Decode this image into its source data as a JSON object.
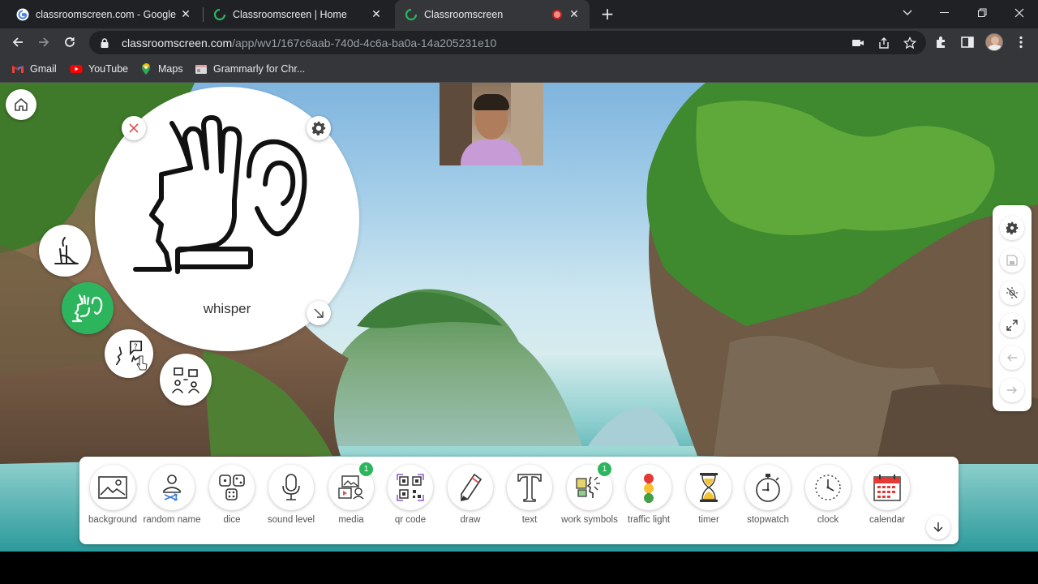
{
  "browser": {
    "tabs": [
      {
        "title": "classroomscreen.com - Google S",
        "favicon": "google-icon",
        "active": false
      },
      {
        "title": "Classroomscreen | Home",
        "favicon": "classroomscreen-icon",
        "active": false
      },
      {
        "title": "Classroomscreen",
        "favicon": "classroomscreen-icon",
        "active": true,
        "recording": true
      }
    ],
    "url_host": "classroomscreen.com",
    "url_path": "/app/wv1/167c6aab-740d-4c6a-ba0a-14a205231e10",
    "bookmarks": [
      {
        "label": "Gmail",
        "icon": "gmail-icon"
      },
      {
        "label": "YouTube",
        "icon": "youtube-icon"
      },
      {
        "label": "Maps",
        "icon": "maps-icon"
      },
      {
        "label": "Grammarly for Chr...",
        "icon": "grammarly-icon"
      }
    ]
  },
  "work_symbol": {
    "label": "whisper",
    "options": [
      "stand-quietly",
      "whisper",
      "ask-partner",
      "work-together"
    ],
    "selected": "whisper",
    "accent": "#2db55d"
  },
  "right_panel": [
    "gear-icon",
    "save-icon",
    "hide-icon",
    "fullscreen-icon",
    "undo-icon",
    "redo-icon"
  ],
  "dock": {
    "items": [
      {
        "label": "background",
        "icon": "image-icon"
      },
      {
        "label": "random name",
        "icon": "person-shuffle-icon"
      },
      {
        "label": "dice",
        "icon": "dice-icon"
      },
      {
        "label": "sound level",
        "icon": "microphone-icon"
      },
      {
        "label": "media",
        "icon": "media-icon",
        "badge": "1"
      },
      {
        "label": "qr code",
        "icon": "qr-code-icon"
      },
      {
        "label": "draw",
        "icon": "pencil-icon"
      },
      {
        "label": "text",
        "icon": "text-icon"
      },
      {
        "label": "work symbols",
        "icon": "work-symbols-icon",
        "badge": "1"
      },
      {
        "label": "traffic light",
        "icon": "traffic-light-icon"
      },
      {
        "label": "timer",
        "icon": "hourglass-icon"
      },
      {
        "label": "stopwatch",
        "icon": "stopwatch-icon"
      },
      {
        "label": "clock",
        "icon": "clock-icon"
      },
      {
        "label": "calendar",
        "icon": "calendar-icon"
      }
    ]
  },
  "colors": {
    "badge": "#2db55d",
    "traffic_red": "#e53935",
    "traffic_yellow": "#fbc02d",
    "traffic_green": "#43a047",
    "calendar_red": "#e53935"
  }
}
